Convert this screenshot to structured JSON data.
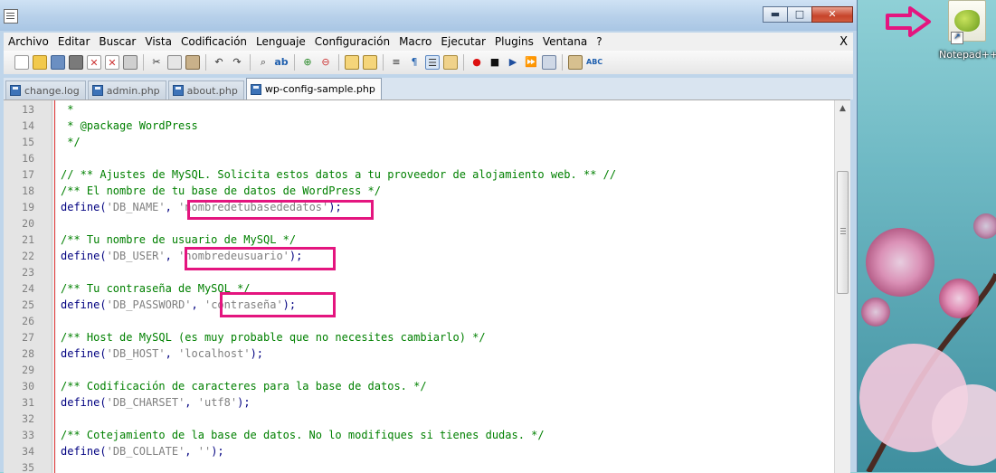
{
  "window": {
    "controls": {
      "minimize": "▬",
      "maximize": "□",
      "close": "✕"
    }
  },
  "menu": [
    "Archivo",
    "Editar",
    "Buscar",
    "Vista",
    "Codificación",
    "Lenguaje",
    "Configuración",
    "Macro",
    "Ejecutar",
    "Plugins",
    "Ventana",
    "?"
  ],
  "menu_close": "X",
  "tabs": [
    {
      "label": "change.log",
      "active": false
    },
    {
      "label": "admin.php",
      "active": false
    },
    {
      "label": "about.php",
      "active": false
    },
    {
      "label": "wp-config-sample.php",
      "active": true
    }
  ],
  "desktop_icon": {
    "label": "Notepad++",
    "icon": "notepadpp-chameleon-icon"
  },
  "colors": {
    "highlight": "#e4157f",
    "comment": "#008000",
    "keyword": "#000080",
    "string": "#808080"
  },
  "lines": [
    {
      "n": "13",
      "parts": [
        {
          "t": " *",
          "c": "cmt"
        }
      ]
    },
    {
      "n": "14",
      "parts": [
        {
          "t": " * @package WordPress",
          "c": "cmt"
        }
      ]
    },
    {
      "n": "15",
      "parts": [
        {
          "t": " */",
          "c": "cmt"
        }
      ]
    },
    {
      "n": "16",
      "parts": []
    },
    {
      "n": "17",
      "parts": [
        {
          "t": "// ** Ajustes de MySQL. Solicita estos datos a tu proveedor de alojamiento web. ** //",
          "c": "cmt"
        }
      ]
    },
    {
      "n": "18",
      "parts": [
        {
          "t": "/** El nombre de tu base de datos de WordPress */",
          "c": "cmt"
        }
      ]
    },
    {
      "n": "19",
      "parts": [
        {
          "t": "define",
          "c": "kw"
        },
        {
          "t": "(",
          "c": "pun"
        },
        {
          "t": "'DB_NAME'",
          "c": "str"
        },
        {
          "t": ", ",
          "c": "pun"
        },
        {
          "t": "'nombredetubasededatos'",
          "c": "str"
        },
        {
          "t": ");",
          "c": "pun"
        }
      ]
    },
    {
      "n": "20",
      "parts": []
    },
    {
      "n": "21",
      "parts": [
        {
          "t": "/** Tu nombre de usuario de MySQL */",
          "c": "cmt"
        }
      ]
    },
    {
      "n": "22",
      "parts": [
        {
          "t": "define",
          "c": "kw"
        },
        {
          "t": "(",
          "c": "pun"
        },
        {
          "t": "'DB_USER'",
          "c": "str"
        },
        {
          "t": ", ",
          "c": "pun"
        },
        {
          "t": "'nombredeusuario'",
          "c": "str"
        },
        {
          "t": ");",
          "c": "pun"
        }
      ]
    },
    {
      "n": "23",
      "parts": []
    },
    {
      "n": "24",
      "parts": [
        {
          "t": "/** Tu contraseña de MySQL */",
          "c": "cmt"
        }
      ]
    },
    {
      "n": "25",
      "parts": [
        {
          "t": "define",
          "c": "kw"
        },
        {
          "t": "(",
          "c": "pun"
        },
        {
          "t": "'DB_PASSWORD'",
          "c": "str"
        },
        {
          "t": ", ",
          "c": "pun"
        },
        {
          "t": "'contraseña'",
          "c": "str"
        },
        {
          "t": ");",
          "c": "pun"
        }
      ]
    },
    {
      "n": "26",
      "parts": []
    },
    {
      "n": "27",
      "parts": [
        {
          "t": "/** Host de MySQL (es muy probable que no necesites cambiarlo) */",
          "c": "cmt"
        }
      ]
    },
    {
      "n": "28",
      "parts": [
        {
          "t": "define",
          "c": "kw"
        },
        {
          "t": "(",
          "c": "pun"
        },
        {
          "t": "'DB_HOST'",
          "c": "str"
        },
        {
          "t": ", ",
          "c": "pun"
        },
        {
          "t": "'localhost'",
          "c": "str"
        },
        {
          "t": ");",
          "c": "pun"
        }
      ]
    },
    {
      "n": "29",
      "parts": []
    },
    {
      "n": "30",
      "parts": [
        {
          "t": "/** Codificación de caracteres para la base de datos. */",
          "c": "cmt"
        }
      ]
    },
    {
      "n": "31",
      "parts": [
        {
          "t": "define",
          "c": "kw"
        },
        {
          "t": "(",
          "c": "pun"
        },
        {
          "t": "'DB_CHARSET'",
          "c": "str"
        },
        {
          "t": ", ",
          "c": "pun"
        },
        {
          "t": "'utf8'",
          "c": "str"
        },
        {
          "t": ");",
          "c": "pun"
        }
      ]
    },
    {
      "n": "32",
      "parts": []
    },
    {
      "n": "33",
      "parts": [
        {
          "t": "/** Cotejamiento de la base de datos. No lo modifiques si tienes dudas. */",
          "c": "cmt"
        }
      ]
    },
    {
      "n": "34",
      "parts": [
        {
          "t": "define",
          "c": "kw"
        },
        {
          "t": "(",
          "c": "pun"
        },
        {
          "t": "'DB_COLLATE'",
          "c": "str"
        },
        {
          "t": ", ",
          "c": "pun"
        },
        {
          "t": "''",
          "c": "str"
        },
        {
          "t": ");",
          "c": "pun"
        }
      ]
    },
    {
      "n": "35",
      "parts": []
    }
  ]
}
